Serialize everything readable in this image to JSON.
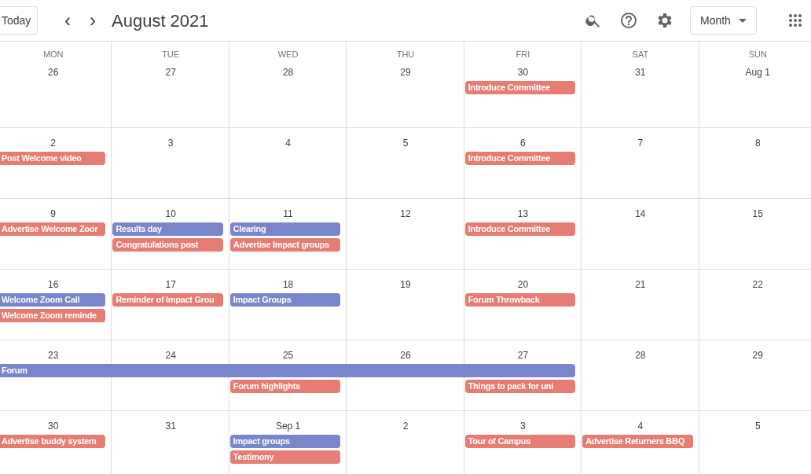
{
  "toolbar": {
    "today_button": "Today",
    "prev": "‹",
    "next": "›",
    "title": "August 2021",
    "view_menu": "Month"
  },
  "weekdays": [
    "MON",
    "TUE",
    "WED",
    "THU",
    "FRI",
    "SAT",
    "SUN"
  ],
  "weeks": [
    {
      "days": [
        {
          "date": "26"
        },
        {
          "date": "27"
        },
        {
          "date": "28"
        },
        {
          "date": "29"
        },
        {
          "date": "30",
          "events": [
            {
              "title": "Introduce Committee",
              "color": "#e67c73"
            }
          ]
        },
        {
          "date": "31"
        },
        {
          "date": "Aug 1"
        }
      ]
    },
    {
      "days": [
        {
          "date": "2",
          "events": [
            {
              "title": "Post Welcome video",
              "color": "#e67c73"
            }
          ]
        },
        {
          "date": "3"
        },
        {
          "date": "4"
        },
        {
          "date": "5"
        },
        {
          "date": "6",
          "events": [
            {
              "title": "Introduce Committee",
              "color": "#e67c73"
            }
          ]
        },
        {
          "date": "7"
        },
        {
          "date": "8"
        }
      ]
    },
    {
      "days": [
        {
          "date": "9",
          "events": [
            {
              "title": "Advertise Welcome Zoor",
              "color": "#e67c73"
            }
          ]
        },
        {
          "date": "10",
          "events": [
            {
              "title": "Results day",
              "color": "#7986cb"
            },
            {
              "title": "Congratulations post",
              "color": "#e67c73"
            }
          ]
        },
        {
          "date": "11",
          "events": [
            {
              "title": "Clearing",
              "color": "#7986cb"
            },
            {
              "title": "Advertise Impact groups",
              "color": "#e67c73"
            }
          ]
        },
        {
          "date": "12"
        },
        {
          "date": "13",
          "events": [
            {
              "title": "Introduce Committee",
              "color": "#e67c73"
            }
          ]
        },
        {
          "date": "14"
        },
        {
          "date": "15"
        }
      ]
    },
    {
      "days": [
        {
          "date": "16",
          "events": [
            {
              "title": "Welcome Zoom Call",
              "color": "#7986cb"
            },
            {
              "title": "Welcome Zoom reminde",
              "color": "#e67c73"
            }
          ]
        },
        {
          "date": "17",
          "events": [
            {
              "title": "Reminder of Impact Grou",
              "color": "#e67c73"
            }
          ]
        },
        {
          "date": "18",
          "events": [
            {
              "title": "Impact Groups",
              "color": "#7986cb"
            }
          ]
        },
        {
          "date": "19"
        },
        {
          "date": "20",
          "events": [
            {
              "title": "Forum Throwback",
              "color": "#e67c73"
            }
          ]
        },
        {
          "date": "21"
        },
        {
          "date": "22"
        }
      ]
    },
    {
      "days": [
        {
          "date": "23",
          "events": [
            {
              "title": "Forum",
              "color": "#7986cb",
              "kind": "starts"
            }
          ]
        },
        {
          "date": "24",
          "events": [
            {
              "kind": "continued"
            }
          ]
        },
        {
          "date": "25",
          "events": [
            {
              "kind": "continued"
            },
            {
              "title": "Forum highlights",
              "color": "#e67c73"
            }
          ]
        },
        {
          "date": "26",
          "events": [
            {
              "kind": "continued"
            }
          ]
        },
        {
          "date": "27",
          "events": [
            {
              "kind": "continued"
            },
            {
              "title": "Things to pack for uni",
              "color": "#e67c73"
            }
          ]
        },
        {
          "date": "28"
        },
        {
          "date": "29"
        }
      ]
    },
    {
      "days": [
        {
          "date": "30",
          "events": [
            {
              "title": "Advertise buddy system",
              "color": "#e67c73"
            }
          ]
        },
        {
          "date": "31"
        },
        {
          "date": "Sep 1",
          "events": [
            {
              "title": "Impact groups",
              "color": "#7986cb"
            },
            {
              "title": "Testimony",
              "color": "#e67c73"
            }
          ]
        },
        {
          "date": "2"
        },
        {
          "date": "3",
          "events": [
            {
              "title": "Tour of Campus",
              "color": "#e67c73"
            }
          ]
        },
        {
          "date": "4",
          "events": [
            {
              "title": "Advertise Returners BBQ",
              "color": "#e67c73"
            }
          ]
        },
        {
          "date": "5"
        }
      ]
    }
  ]
}
